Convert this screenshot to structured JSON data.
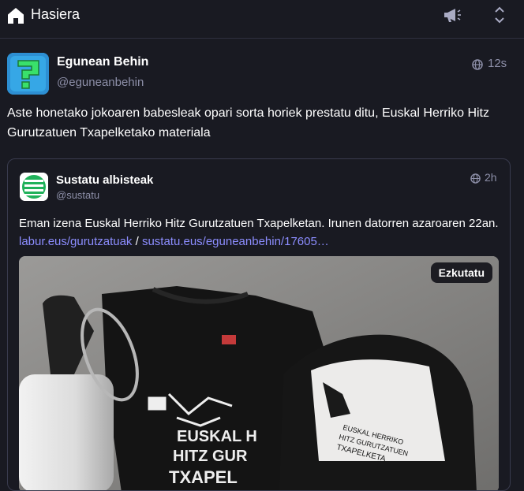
{
  "header": {
    "title": "Hasiera",
    "icons": [
      "home-icon",
      "announcement-icon",
      "collapse-icon"
    ]
  },
  "status": {
    "author": {
      "display_name": "Egunean Behin",
      "handle": "@eguneanbehin"
    },
    "time": "12s",
    "visibility_icon": "globe-icon",
    "text": "Aste honetako jokoaren babesleak opari sorta horiek prestatu ditu, Euskal Herriko Hitz Gurutzatuen Txapelketako materiala"
  },
  "quote": {
    "author": {
      "display_name": "Sustatu albisteak",
      "handle": "@sustatu"
    },
    "time": "2h",
    "text_before": "Eman izena  Euskal Herriko Hitz Gurutzatuen Txapelketan. Irunen datorren azaroaren 22an. ",
    "link1": "labur.eus/gurutzatuak",
    "separator": " / ",
    "link2": "sustatu.eus/eguneanbehin/17605…",
    "media": {
      "hide_label": "Ezkutatu",
      "image_text_lines": [
        "EUSKAL H",
        "HITZ GUR",
        "TXAPEL"
      ],
      "cap_text_lines": [
        "EUSKAL HERRIKO",
        "HITZ GURUTZATUEN",
        "TXAPELKETA"
      ]
    }
  },
  "colors": {
    "background": "#191a22",
    "link": "#8c8dff",
    "muted": "#8d8fa8",
    "border": "#393b4e"
  }
}
